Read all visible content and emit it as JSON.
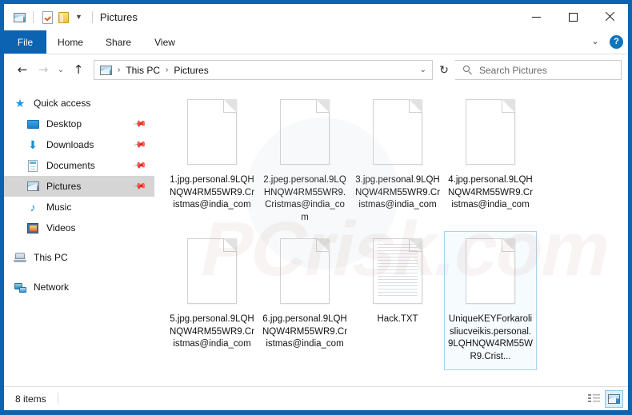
{
  "window": {
    "title": "Pictures",
    "quick_access": [
      {
        "name": "explorer-photo-icon",
        "icon": "photo-icon"
      },
      {
        "name": "properties-icon",
        "icon": "document-check-icon"
      },
      {
        "name": "new-folder-icon",
        "icon": "folder-icon"
      },
      {
        "name": "customize-qat-icon",
        "icon": "chevron-down-icon"
      }
    ],
    "controls": {
      "minimize": "minimize-icon",
      "maximize": "maximize-icon",
      "close": "close-icon"
    }
  },
  "ribbon": {
    "tabs": [
      {
        "label": "File",
        "active": true
      },
      {
        "label": "Home",
        "active": false
      },
      {
        "label": "Share",
        "active": false
      },
      {
        "label": "View",
        "active": false
      }
    ],
    "expand_icon": "chevron-down-icon",
    "help_label": "?"
  },
  "navbar": {
    "back_icon": "arrow-left-icon",
    "forward_icon": "arrow-right-icon",
    "recent_icon": "chevron-down-icon",
    "up_icon": "arrow-up-icon",
    "address_icon": "photo-icon",
    "breadcrumbs": [
      "This PC",
      "Pictures"
    ],
    "separator": "›",
    "dropdown_icon": "chevron-down-icon",
    "refresh_icon": "↻",
    "search_placeholder": "Search Pictures",
    "search_value": "",
    "search_icon": "search-icon"
  },
  "sidebar": {
    "items": [
      {
        "label": "Quick access",
        "icon": "star-icon",
        "level": "root",
        "pinned": false,
        "selected": false
      },
      {
        "label": "Desktop",
        "icon": "desktop-icon",
        "level": "child",
        "pinned": true,
        "selected": false
      },
      {
        "label": "Downloads",
        "icon": "download-icon",
        "level": "child",
        "pinned": true,
        "selected": false
      },
      {
        "label": "Documents",
        "icon": "documents-icon",
        "level": "child",
        "pinned": true,
        "selected": false
      },
      {
        "label": "Pictures",
        "icon": "pictures-icon",
        "level": "child",
        "pinned": true,
        "selected": true
      },
      {
        "label": "Music",
        "icon": "music-icon",
        "level": "child",
        "pinned": false,
        "selected": false
      },
      {
        "label": "Videos",
        "icon": "videos-icon",
        "level": "child",
        "pinned": false,
        "selected": false
      },
      {
        "label": "This PC",
        "icon": "this-pc-icon",
        "level": "root",
        "pinned": false,
        "selected": false
      },
      {
        "label": "Network",
        "icon": "network-icon",
        "level": "root",
        "pinned": false,
        "selected": false
      }
    ]
  },
  "files": [
    {
      "name": "1.jpg.personal.9LQHNQW4RM55WR9.Cristmas@india_com",
      "icon": "blank-file-icon",
      "selected": false
    },
    {
      "name": "2.jpeg.personal.9LQHNQW4RM55WR9.Cristmas@india_com",
      "icon": "blank-file-icon",
      "selected": false
    },
    {
      "name": "3.jpg.personal.9LQHNQW4RM55WR9.Cristmas@india_com",
      "icon": "blank-file-icon",
      "selected": false
    },
    {
      "name": "4.jpg.personal.9LQHNQW4RM55WR9.Cristmas@india_com",
      "icon": "blank-file-icon",
      "selected": false
    },
    {
      "name": "5.jpg.personal.9LQHNQW4RM55WR9.Cristmas@india_com",
      "icon": "blank-file-icon",
      "selected": false
    },
    {
      "name": "6.jpg.personal.9LQHNQW4RM55WR9.Cristmas@india_com",
      "icon": "blank-file-icon",
      "selected": false
    },
    {
      "name": "Hack.TXT",
      "icon": "text-file-icon",
      "selected": false
    },
    {
      "name": "UniqueKEYForkarolisliucveikis.personal.9LQHNQW4RM55WR9.Crist...",
      "icon": "blank-file-icon",
      "selected": true
    }
  ],
  "statusbar": {
    "item_count": "8 items",
    "views": [
      {
        "name": "details-view-button",
        "icon": "details-icon",
        "active": false
      },
      {
        "name": "large-icons-view-button",
        "icon": "thumbnails-icon",
        "active": true
      }
    ]
  },
  "watermark": {
    "text": "PCrisk.com"
  },
  "colors": {
    "window_border": "#0b63b1",
    "tab_active_bg": "#0b63b1",
    "selection_border": "#a6d3ef",
    "sidebar_selected_bg": "#d5d5d5",
    "help_button_bg": "#0e74bd"
  }
}
